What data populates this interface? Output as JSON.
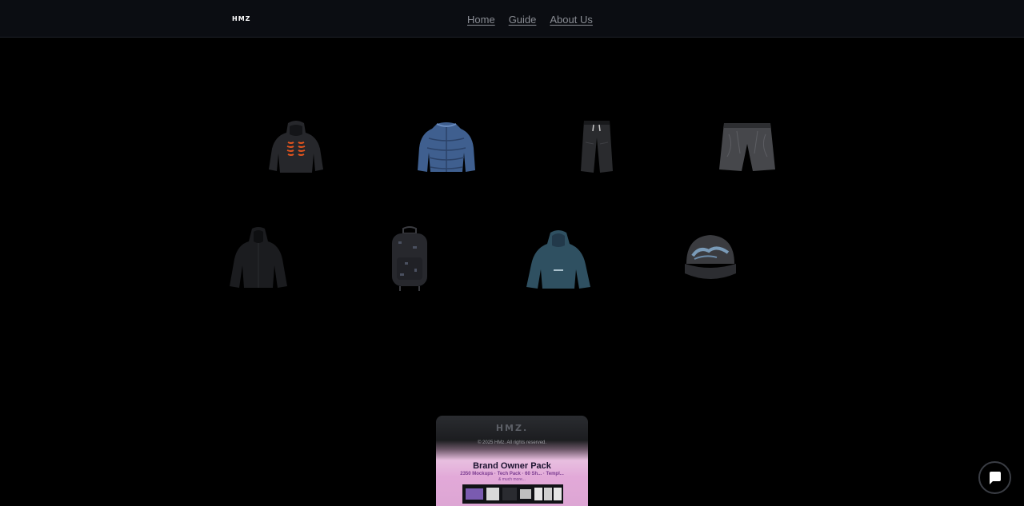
{
  "header": {
    "logo": "HMZ",
    "nav": [
      {
        "label": "Home"
      },
      {
        "label": "Guide"
      },
      {
        "label": "About Us"
      }
    ]
  },
  "products": [
    {
      "name": "hoodie-orange-print",
      "icon": "hoodie-icon"
    },
    {
      "name": "blue-puffer-jacket",
      "icon": "puffer-jacket-icon"
    },
    {
      "name": "black-denim-pants",
      "icon": "pants-icon"
    },
    {
      "name": "grey-denim-shorts",
      "icon": "shorts-icon"
    },
    {
      "name": "black-hooded-jacket",
      "icon": "jacket-icon"
    },
    {
      "name": "black-backpack",
      "icon": "backpack-icon"
    },
    {
      "name": "teal-hoodie",
      "icon": "hoodie-icon"
    },
    {
      "name": "grey-cap",
      "icon": "cap-icon"
    }
  ],
  "pack": {
    "brand": "HMZ.",
    "copyright": "© 2025 HMz. All rights reserved.",
    "title": "Brand Owner Pack",
    "subtitle": "2350 Mockups · Tech Pack · 60 Sh... · Templ...",
    "subtitle2": "& much more..."
  },
  "chat": {
    "icon": "chat-icon"
  },
  "colors": {
    "background": "#000000",
    "header": "#0b0d12",
    "nav_text": "#8a8d94",
    "pack_pink": "#e2a9d8"
  }
}
